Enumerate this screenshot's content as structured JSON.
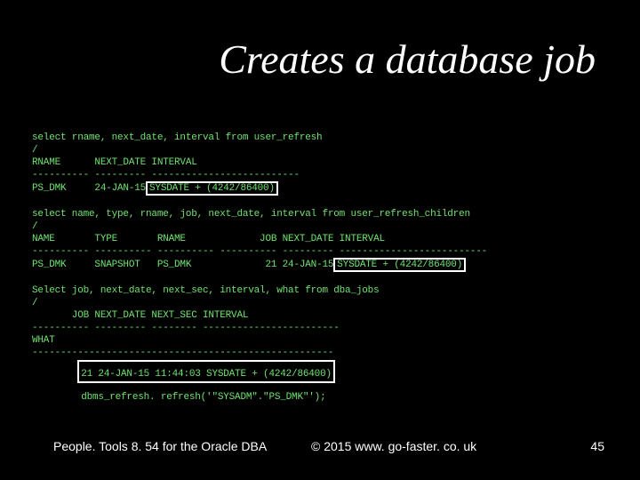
{
  "title": "Creates a database job",
  "code": {
    "line1": "select rname, next_date, interval from user_refresh",
    "line2": "/",
    "line3": "RNAME      NEXT_DATE INTERVAL",
    "line4": "---------- --------- --------------------------",
    "line5a": "PS_DMK     24-JAN-15",
    "hl1": "SYSDATE + (4242/86400)",
    "blank1": "",
    "line6": "select name, type, rname, job, next_date, interval from user_refresh_children",
    "line7": "/",
    "line8": "NAME       TYPE       RNAME             JOB NEXT_DATE INTERVAL",
    "line9": "---------- ---------- ---------- ---------- --------- --------------------------",
    "line10a": "PS_DMK     SNAPSHOT   PS_DMK             21 24-JAN-15",
    "hl2": "SYSDATE + (4242/86400)",
    "blank2": "",
    "line11": "Select job, next_date, next_sec, interval, what from dba_jobs",
    "line12": "/",
    "line13": "       JOB NEXT_DATE NEXT_SEC INTERVAL",
    "line14": "---------- --------- -------- ------------------------",
    "line15": "WHAT",
    "line16": "-----------------------------------------------------",
    "line17a": "        ",
    "hl3top": "21 24-JAN-15 11:44:03 SYSDATE + (4242/86400)",
    "hl3bot": "dbms_refresh. refresh('\"SYSADM\".\"PS_DMK\"');"
  },
  "footer": {
    "left": "People. Tools 8. 54 for the Oracle DBA",
    "center": "© 2015 www. go-faster. co. uk",
    "right": "45"
  }
}
